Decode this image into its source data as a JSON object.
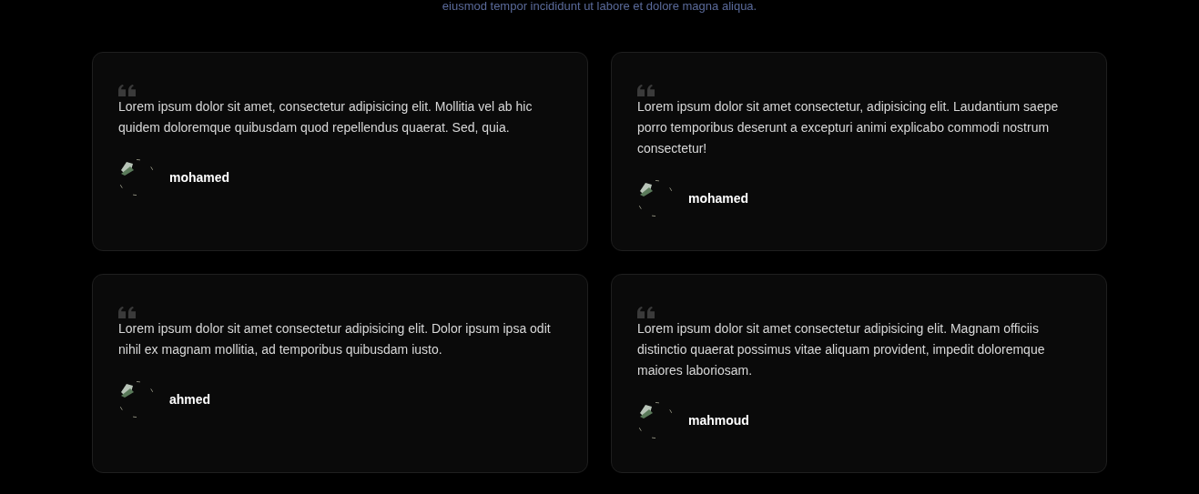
{
  "intro": "eiusmod tempor incididunt ut labore et dolore magna aliqua.",
  "testimonials": [
    {
      "text": "Lorem ipsum dolor sit amet, consectetur adipisicing elit. Mollitia vel ab hic quidem doloremque quibusdam quod repellendus quaerat. Sed, quia.",
      "name": "mohamed"
    },
    {
      "text": "Lorem ipsum dolor sit amet consectetur, adipisicing elit. Laudantium saepe porro temporibus deserunt a excepturi animi explicabo commodi nostrum consectetur!",
      "name": "mohamed"
    },
    {
      "text": "Lorem ipsum dolor sit amet consectetur adipisicing elit. Dolor ipsum ipsa odit nihil ex magnam mollitia, ad temporibus quibusdam iusto.",
      "name": "ahmed"
    },
    {
      "text": "Lorem ipsum dolor sit amet consectetur adipisicing elit. Magnam officiis distinctio quaerat possimus vitae aliquam provident, impedit doloremque maiores laboriosam.",
      "name": "mahmoud"
    }
  ]
}
